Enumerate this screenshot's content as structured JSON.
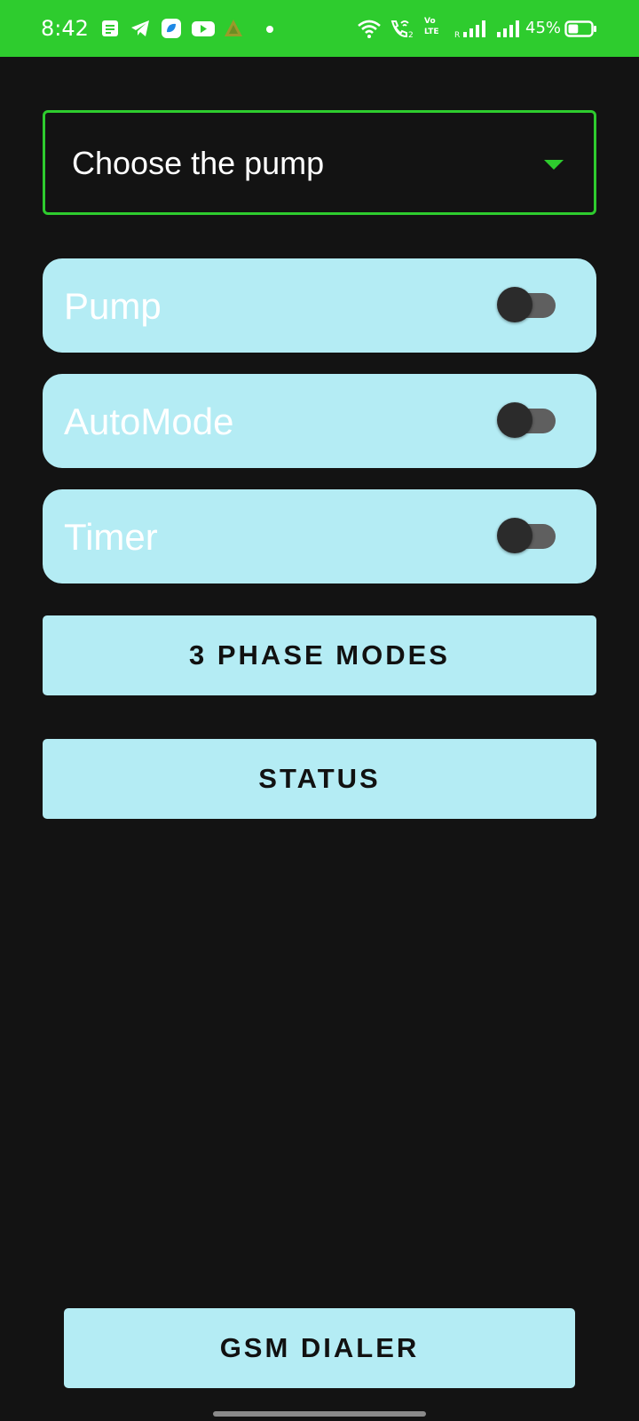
{
  "status_bar": {
    "time": "8:42",
    "battery_percent": "45%",
    "battery_level": 0.45,
    "background_color": "#2ecc2e",
    "left_icons": [
      "notes-icon",
      "telegram-icon",
      "app-icon",
      "youtube-icon",
      "drive-icon"
    ],
    "right_icons": [
      "wifi-icon",
      "wifi-calling-icon",
      "volte-icon",
      "signal-roaming-icon",
      "signal-icon",
      "battery-icon"
    ],
    "volte_label": "Vo LTE",
    "roaming_label": "R"
  },
  "pump_select": {
    "label": "Choose the pump",
    "border_color": "#2ecc2e",
    "icon": "dropdown-arrow-icon"
  },
  "toggles": [
    {
      "label": "Pump",
      "checked": false
    },
    {
      "label": "AutoMode",
      "checked": false
    },
    {
      "label": "Timer",
      "checked": false
    }
  ],
  "buttons": {
    "phase_modes": "3 PHASE MODES",
    "status": "STATUS",
    "gsm_dialer": "GSM DIALER"
  },
  "colors": {
    "background": "#131313",
    "card": "#b4ecf4",
    "accent": "#2ecc2e"
  }
}
